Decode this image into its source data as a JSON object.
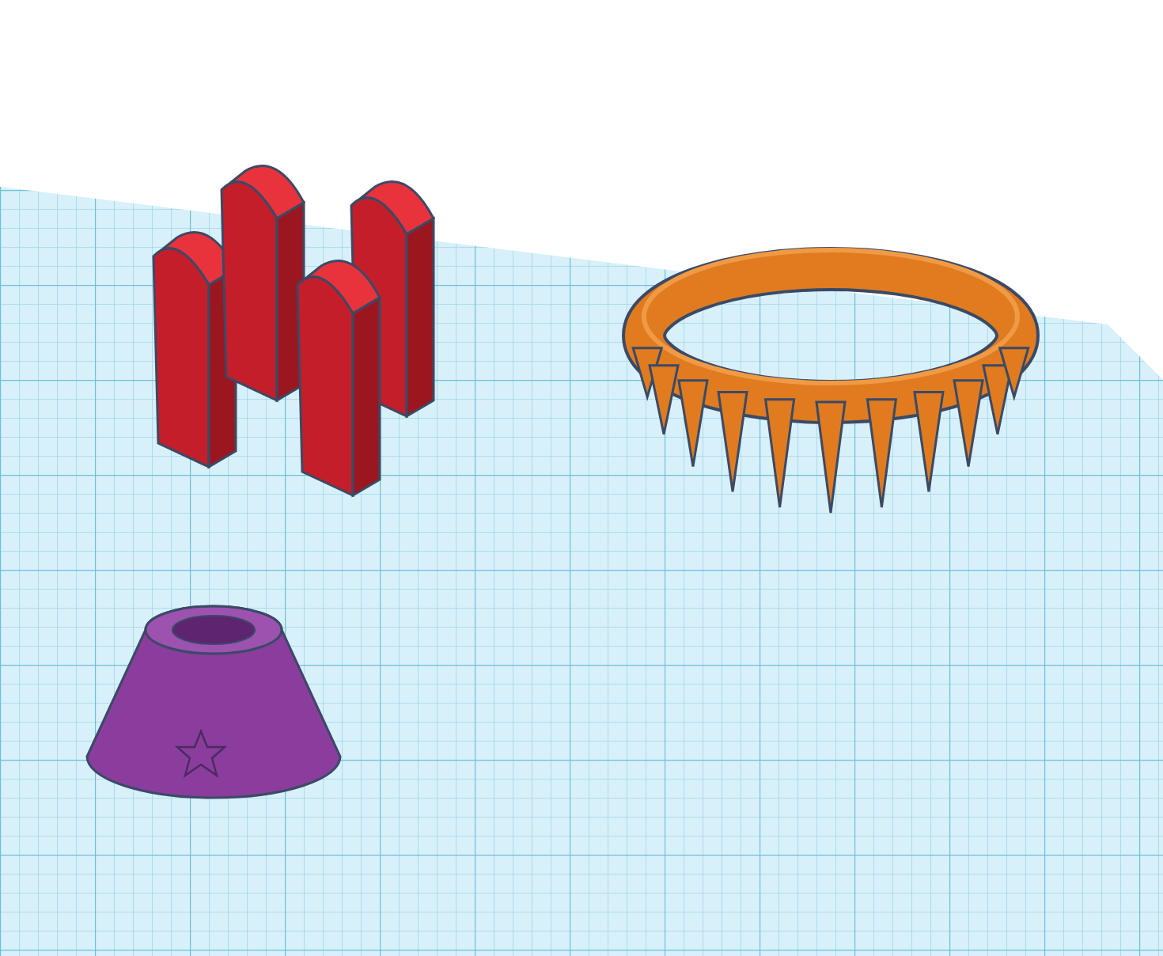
{
  "workplane": {
    "shapes": [
      {
        "kind": "curved-wall",
        "color": "#c41e2a"
      },
      {
        "kind": "curved-wall",
        "color": "#c41e2a"
      },
      {
        "kind": "curved-wall",
        "color": "#c41e2a"
      },
      {
        "kind": "curved-wall",
        "color": "#c41e2a"
      },
      {
        "kind": "crown-ring",
        "color": "#e07b20"
      },
      {
        "kind": "cone",
        "color": "#8a3d9c"
      }
    ]
  }
}
